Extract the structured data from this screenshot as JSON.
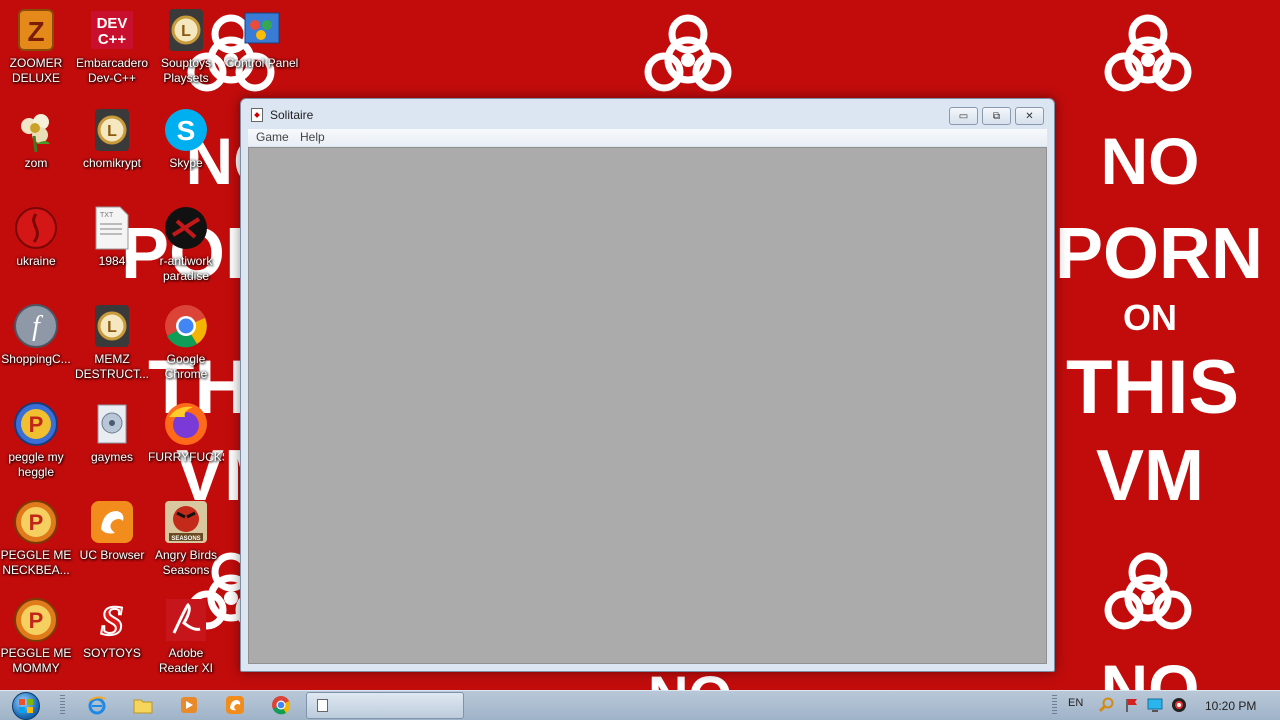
{
  "wallpaper": {
    "slogan_lines": [
      "NO",
      "PORN",
      "ON",
      "THIS",
      "VM"
    ],
    "bottom_text": "NO",
    "color": "#c20c0c"
  },
  "desktop_icons": [
    {
      "label": "ZOOMER DELUXE",
      "icon": "zoomer-icon"
    },
    {
      "label": "Embarcadero Dev-C++",
      "icon": "devcpp-icon"
    },
    {
      "label": "Souptoys Playsets",
      "icon": "shortcut-l-icon"
    },
    {
      "label": "Control Panel",
      "icon": "control-panel-icon"
    },
    {
      "label": "zom",
      "icon": "flower-icon"
    },
    {
      "label": "chomikrypt",
      "icon": "shortcut-l-icon"
    },
    {
      "label": "Skype",
      "icon": "skype-icon"
    },
    {
      "label": "ukraine",
      "icon": "red-circle-icon"
    },
    {
      "label": "1984",
      "icon": "text-file-icon"
    },
    {
      "label": "r-antiwork paradise",
      "icon": "black-circle-icon"
    },
    {
      "label": "ShoppingC...",
      "icon": "flash-icon"
    },
    {
      "label": "MEMZ DESTRUCT...",
      "icon": "shortcut-l-icon"
    },
    {
      "label": "Google Chrome",
      "icon": "chrome-icon"
    },
    {
      "label": "peggle my heggle",
      "icon": "peggle-icon"
    },
    {
      "label": "gaymes",
      "icon": "folder-icon"
    },
    {
      "label": "FURRYFUCKS",
      "icon": "firefox-icon"
    },
    {
      "label": "PEGGLE ME NECKBEA...",
      "icon": "peggle-icon"
    },
    {
      "label": "UC Browser",
      "icon": "uc-browser-icon"
    },
    {
      "label": "Angry Birds Seasons",
      "icon": "angry-birds-icon"
    },
    {
      "label": "PEGGLE ME MOMMY",
      "icon": "peggle-icon"
    },
    {
      "label": "SOYTOYS",
      "icon": "soytoys-icon"
    },
    {
      "label": "Adobe Reader XI",
      "icon": "adobe-reader-icon"
    }
  ],
  "window": {
    "title": "Solitaire",
    "menu": [
      "Game",
      "Help"
    ],
    "minimize_glyph": "▭",
    "maximize_glyph": "⧉",
    "close_glyph": "✕"
  },
  "taskbar": {
    "pinned": [
      "internet-explorer-icon",
      "explorer-icon",
      "media-player-icon",
      "uc-browser-icon",
      "chrome-icon"
    ],
    "task_label": "",
    "language": "EN",
    "time": "10:20 PM"
  }
}
